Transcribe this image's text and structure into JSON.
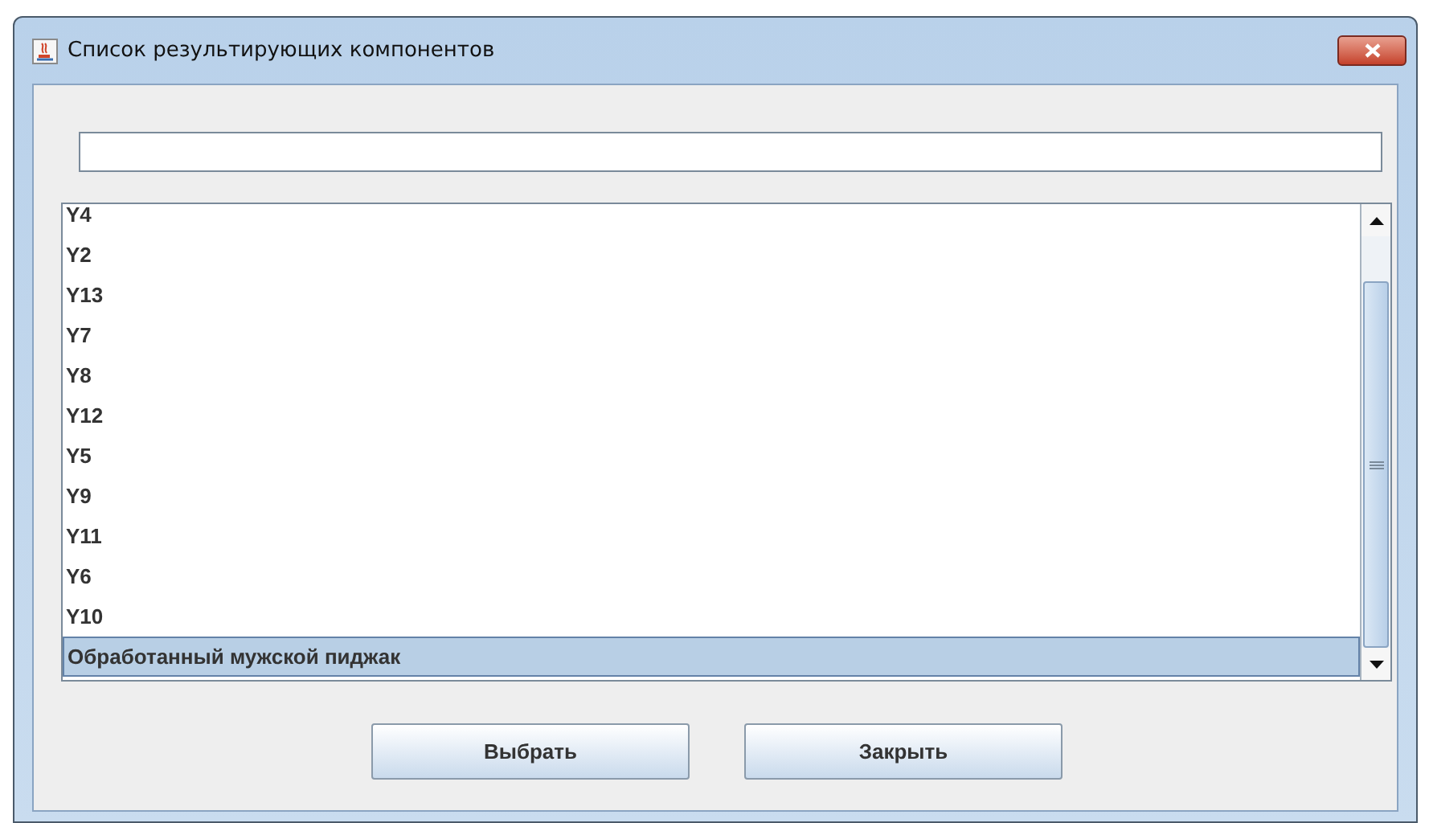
{
  "window": {
    "title": "Список результирующих компонентов"
  },
  "search": {
    "focused": false
  },
  "list": {
    "items": [
      {
        "label": "Y4",
        "selected": false
      },
      {
        "label": "Y2",
        "selected": false
      },
      {
        "label": "Y13",
        "selected": false
      },
      {
        "label": "Y7",
        "selected": false
      },
      {
        "label": "Y8",
        "selected": false
      },
      {
        "label": "Y12",
        "selected": false
      },
      {
        "label": "Y5",
        "selected": false
      },
      {
        "label": "Y9",
        "selected": false
      },
      {
        "label": "Y11",
        "selected": false
      },
      {
        "label": "Y6",
        "selected": false
      },
      {
        "label": "Y10",
        "selected": false
      },
      {
        "label": "Обработанный мужской пиджак",
        "selected": true
      }
    ]
  },
  "buttons": [
    {
      "label": "Выбрать"
    },
    {
      "label": "Закрыть"
    }
  ]
}
